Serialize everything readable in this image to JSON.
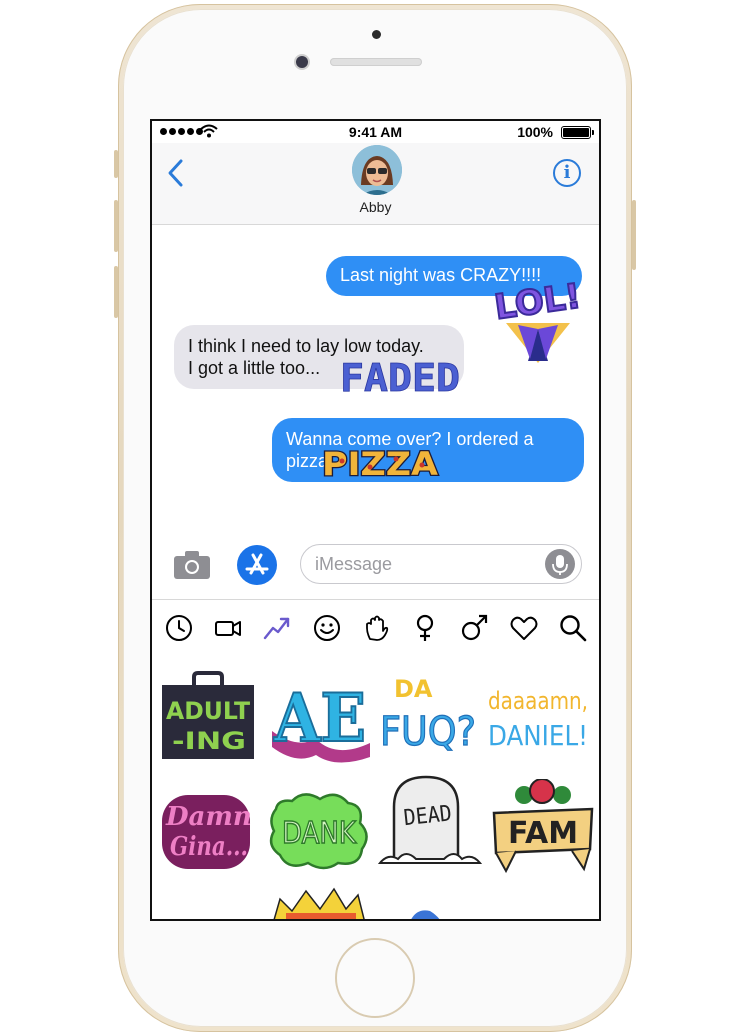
{
  "status_bar": {
    "time": "9:41 AM",
    "battery": "100%"
  },
  "nav": {
    "contact_name": "Abby",
    "info_glyph": "i"
  },
  "messages": [
    {
      "side": "out",
      "text": "Last night was CRAZY!!!!"
    },
    {
      "side": "in",
      "line1": "I think I need to lay low today.",
      "line2": "I got a little too..."
    },
    {
      "side": "out",
      "line1": "Wanna come over? I ordered a",
      "line2": "pizza"
    }
  ],
  "message_stickers": {
    "lol": "LOL!",
    "faded": "FADED",
    "pizza": "PIZZA"
  },
  "compose": {
    "placeholder": "iMessage"
  },
  "categories": [
    "recent-icon",
    "video-icon",
    "trending-icon",
    "emoji-icon",
    "hand-icon",
    "female-icon",
    "male-icon",
    "heart-icon",
    "search-icon"
  ],
  "sticker_grid": [
    {
      "name": "adulting",
      "lines": [
        "ADULT",
        "-ING"
      ]
    },
    {
      "name": "ae",
      "lines": [
        "AE"
      ]
    },
    {
      "name": "da-fuq",
      "lines": [
        "DA",
        "FUQ?"
      ]
    },
    {
      "name": "daaaamn-daniel",
      "lines": [
        "daaaamn,",
        "DANIEL!"
      ]
    },
    {
      "name": "damn-gina",
      "lines": [
        "Damn",
        "Gina..."
      ]
    },
    {
      "name": "dank",
      "lines": [
        "DANK"
      ]
    },
    {
      "name": "dead",
      "lines": [
        "DEAD"
      ]
    },
    {
      "name": "fam",
      "lines": [
        "FAM"
      ]
    }
  ],
  "colors": {
    "bubble_out": "#2f8ff5",
    "bubble_in": "#e6e5eb",
    "accent": "#2a7bd9",
    "phone_gold": "#e9dcc4"
  }
}
